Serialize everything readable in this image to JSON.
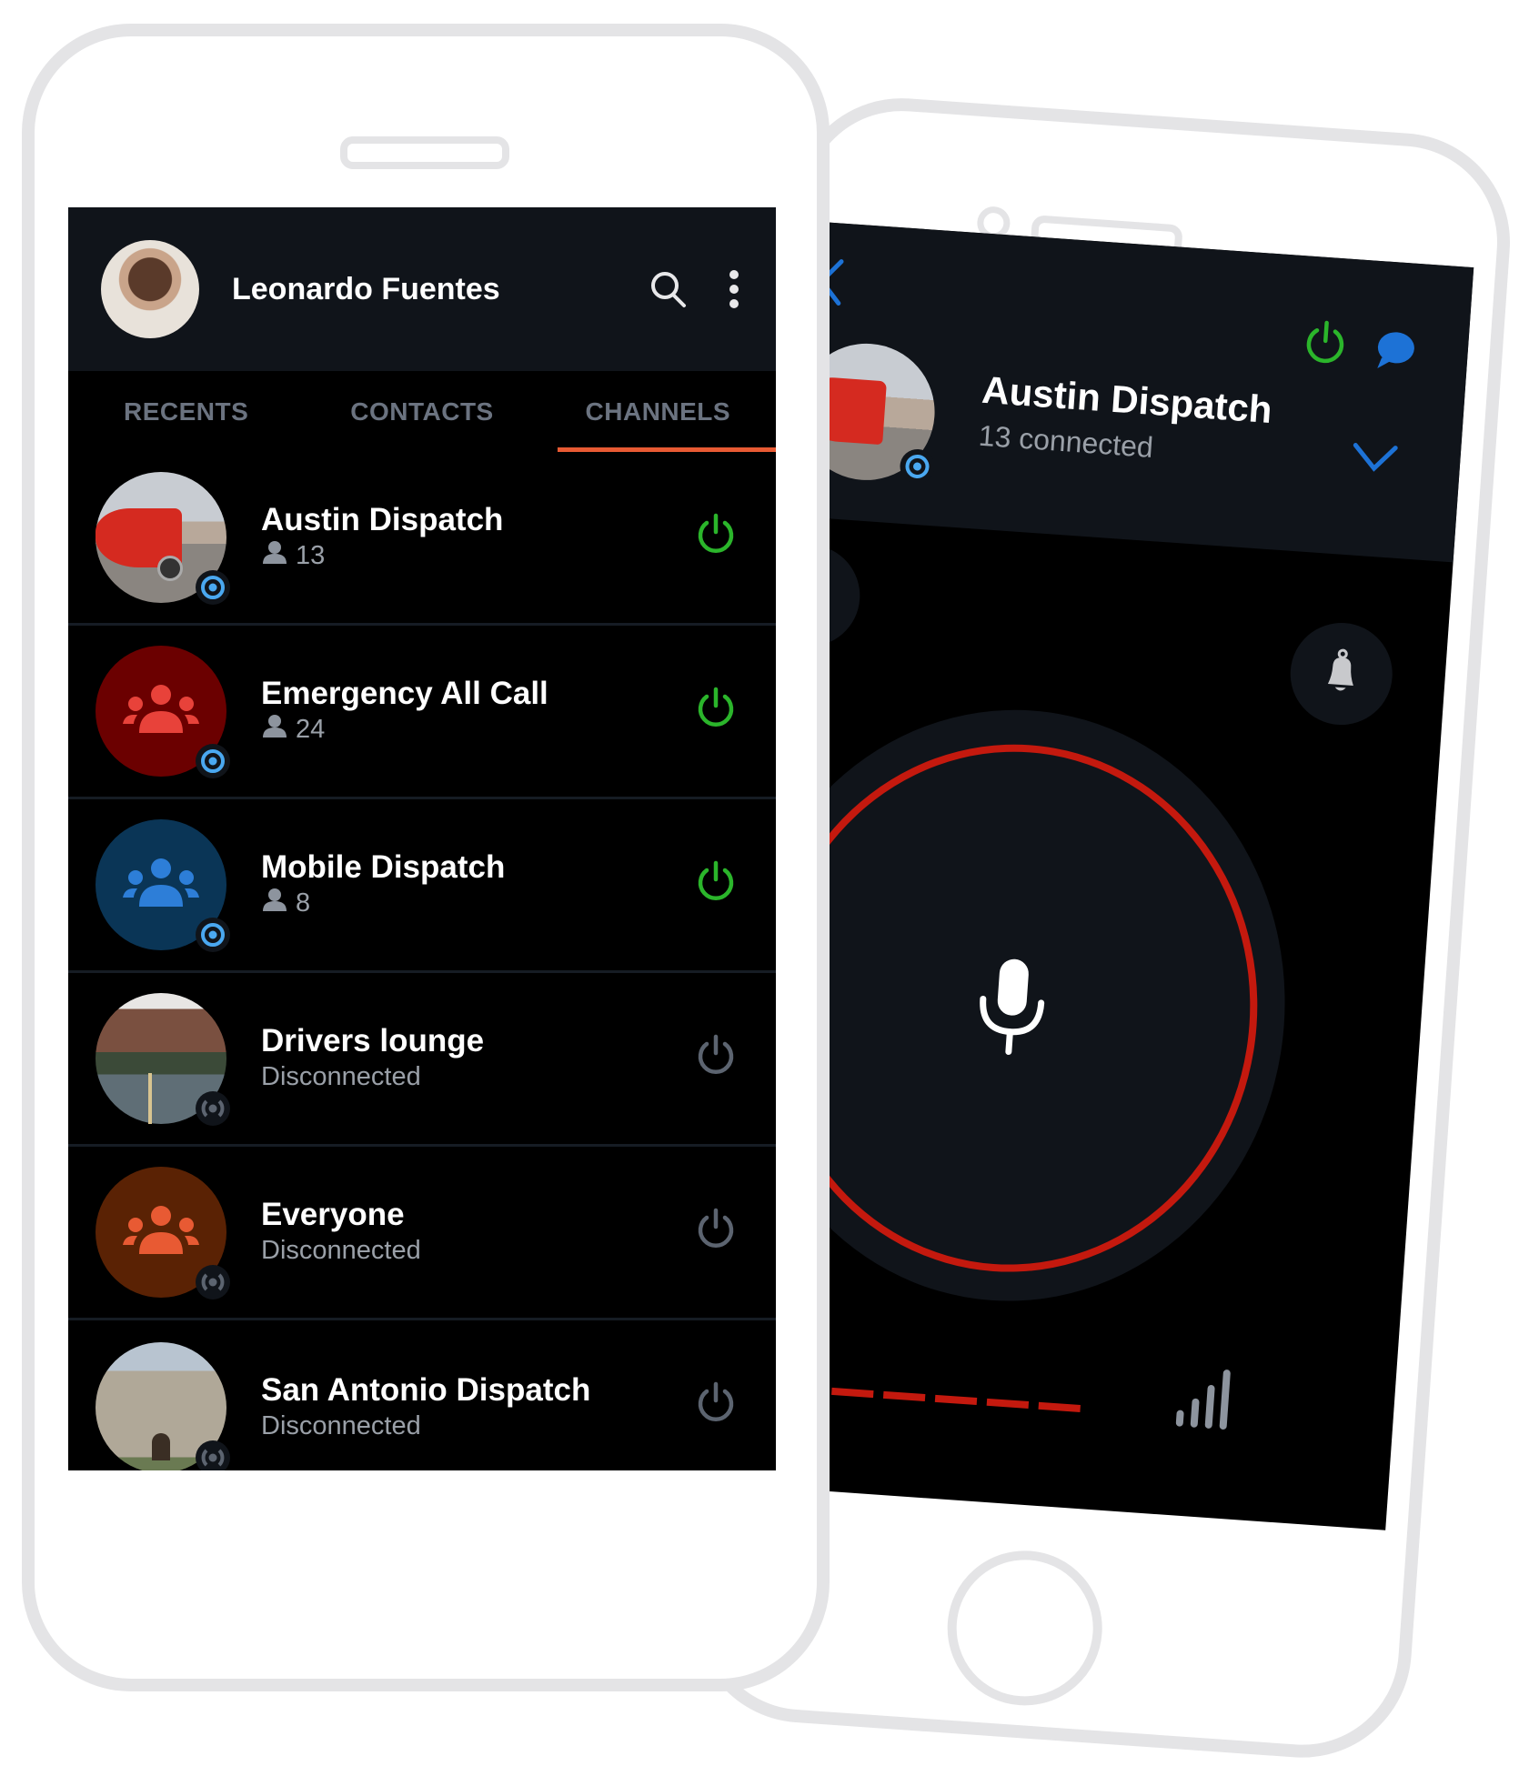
{
  "left_app": {
    "header": {
      "user_name": "Leonardo Fuentes",
      "search_icon": "search-icon",
      "menu_icon": "more-vertical-icon"
    },
    "tabs": [
      {
        "label": "RECENTS",
        "active": false
      },
      {
        "label": "CONTACTS",
        "active": false
      },
      {
        "label": "CHANNELS",
        "active": true
      }
    ],
    "channels": [
      {
        "name": "Austin Dispatch",
        "subtitle": "13",
        "subtitle_type": "member_count",
        "connected": true,
        "avatar": "photo-truck"
      },
      {
        "name": "Emergency All Call",
        "subtitle": "24",
        "subtitle_type": "member_count",
        "connected": true,
        "avatar": "group-icon",
        "avatar_bg": "#6b0000",
        "icon_color": "#e8423a"
      },
      {
        "name": "Mobile Dispatch",
        "subtitle": "8",
        "subtitle_type": "member_count",
        "connected": true,
        "avatar": "group-icon",
        "avatar_bg": "#0a3556",
        "icon_color": "#2d7ed8"
      },
      {
        "name": "Drivers lounge",
        "subtitle": "Disconnected",
        "subtitle_type": "status",
        "connected": false,
        "avatar": "photo-road"
      },
      {
        "name": "Everyone",
        "subtitle": "Disconnected",
        "subtitle_type": "status",
        "connected": false,
        "avatar": "group-icon",
        "avatar_bg": "#5a2204",
        "icon_color": "#e85a33"
      },
      {
        "name": "San Antonio Dispatch",
        "subtitle": "Disconnected",
        "subtitle_type": "status",
        "connected": false,
        "avatar": "photo-alamo"
      }
    ]
  },
  "right_app": {
    "channel_title": "Austin Dispatch",
    "channel_subtitle": "13 connected",
    "icons": [
      "back-chevron-icon",
      "power-icon",
      "chat-bubble-icon",
      "chevron-down-icon",
      "camera-icon",
      "bell-icon",
      "microphone-icon",
      "signal-strength-icon"
    ]
  },
  "colors": {
    "accent_orange": "#e85a33",
    "connected_green": "#2bb52b",
    "disconnected_gray": "#5c6470",
    "blue": "#1d72d6",
    "badge_blue": "#4aa8f0",
    "ptt_red": "#c4190e",
    "header_bg": "#10141a"
  }
}
